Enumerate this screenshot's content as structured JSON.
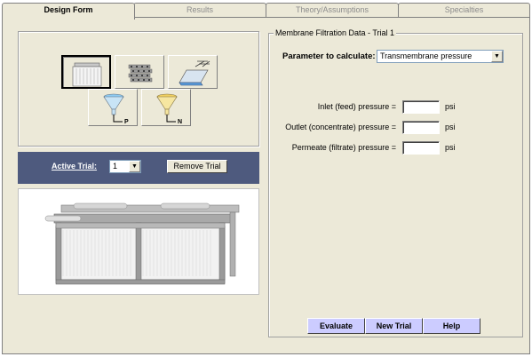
{
  "tabs": [
    {
      "label": "Design Form",
      "active": true
    },
    {
      "label": "Results",
      "active": false
    },
    {
      "label": "Theory/Assumptions",
      "active": false
    },
    {
      "label": "Specialties",
      "active": false
    }
  ],
  "tools": [
    {
      "name": "membrane-module-icon",
      "selected": true
    },
    {
      "name": "hollow-fiber-bundle-icon",
      "selected": false
    },
    {
      "name": "spray-tank-icon",
      "selected": false
    },
    {
      "name": "funnel-p-icon",
      "selected": false
    },
    {
      "name": "funnel-n-icon",
      "selected": false
    }
  ],
  "trial": {
    "label": "Active Trial:",
    "selected": "1",
    "remove_label": "Remove Trial",
    "bar_color": "#4e5a7e"
  },
  "form": {
    "group_title": "Membrane Filtration Data - Trial 1",
    "parameter_label": "Parameter to calculate:",
    "parameter_value": "Transmembrane pressure",
    "fields": [
      {
        "label": "Inlet (feed) pressure =",
        "value": "",
        "unit": "psi"
      },
      {
        "label": "Outlet (concentrate) pressure =",
        "value": "",
        "unit": "psi"
      },
      {
        "label": "Permeate (filtrate) pressure =",
        "value": "",
        "unit": "psi"
      }
    ]
  },
  "icon_labels": {
    "p": "P",
    "n": "N"
  },
  "actions": {
    "evaluate": "Evaluate",
    "new_trial": "New Trial",
    "help": "Help",
    "button_color": "#ccccff"
  }
}
